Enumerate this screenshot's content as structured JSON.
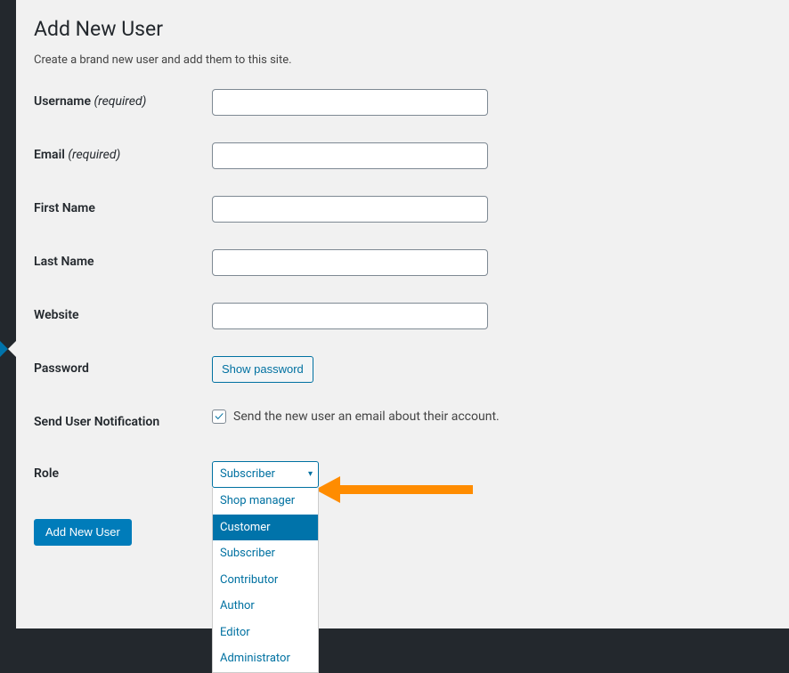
{
  "page": {
    "title": "Add New User",
    "subtitle": "Create a brand new user and add them to this site."
  },
  "fields": {
    "username": {
      "label": "Username",
      "required_suffix": "(required)",
      "value": ""
    },
    "email": {
      "label": "Email",
      "required_suffix": "(required)",
      "value": ""
    },
    "first_name": {
      "label": "First Name",
      "value": ""
    },
    "last_name": {
      "label": "Last Name",
      "value": ""
    },
    "website": {
      "label": "Website",
      "value": ""
    },
    "password": {
      "label": "Password",
      "button_text": "Show password"
    },
    "notification": {
      "label": "Send User Notification",
      "checkbox_label": "Send the new user an email about their account.",
      "checked": true
    },
    "role": {
      "label": "Role",
      "selected": "Subscriber",
      "options": [
        "Shop manager",
        "Customer",
        "Subscriber",
        "Contributor",
        "Author",
        "Editor",
        "Administrator"
      ],
      "highlighted_index": 1
    }
  },
  "submit": {
    "label": "Add New User"
  }
}
